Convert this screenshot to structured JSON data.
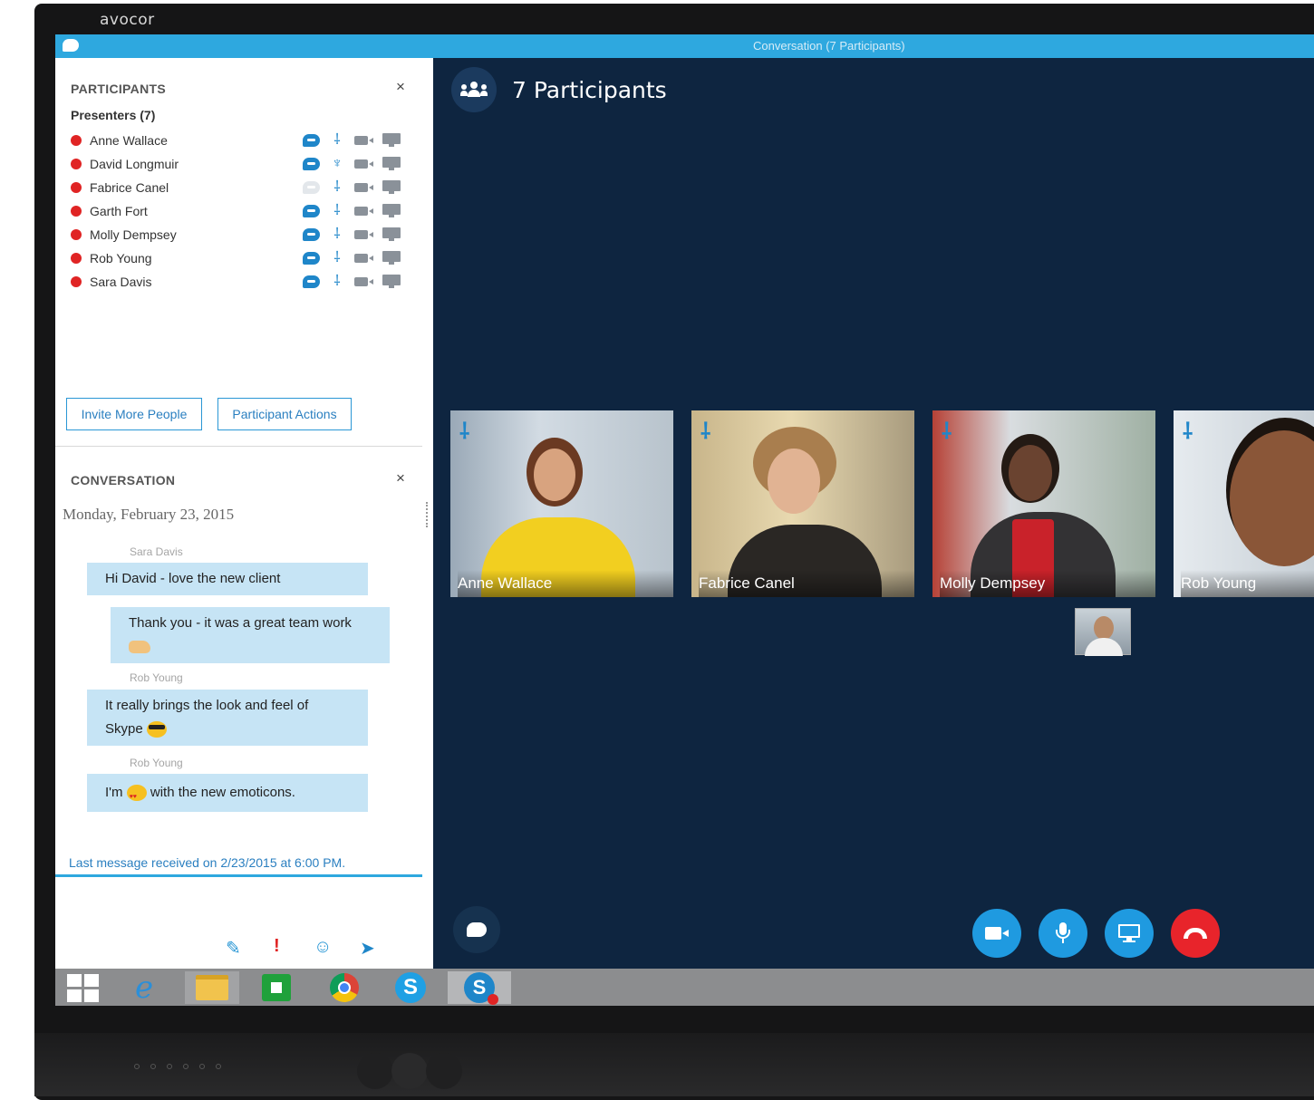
{
  "device": {
    "brand": "avocor"
  },
  "window": {
    "title": "Conversation (7 Participants)"
  },
  "participants_panel": {
    "title": "PARTICIPANTS",
    "close": "×",
    "group_label": "Presenters (7)",
    "people": [
      {
        "name": "Anne Wallace",
        "im": "active",
        "mic": "muted"
      },
      {
        "name": "David Longmuir",
        "im": "active",
        "mic": "on"
      },
      {
        "name": "Fabrice Canel",
        "im": "inactive",
        "mic": "muted"
      },
      {
        "name": "Garth Fort",
        "im": "active",
        "mic": "muted"
      },
      {
        "name": "Molly Dempsey",
        "im": "active",
        "mic": "muted"
      },
      {
        "name": "Rob Young",
        "im": "active",
        "mic": "muted"
      },
      {
        "name": "Sara Davis",
        "im": "active",
        "mic": "muted"
      }
    ],
    "invite_button": "Invite More People",
    "actions_button": "Participant Actions"
  },
  "conversation_panel": {
    "title": "CONVERSATION",
    "close": "×",
    "date": "Monday, February 23, 2015",
    "messages": [
      {
        "sender": "Sara Davis",
        "text": "Hi David - love the new client"
      },
      {
        "sender": "",
        "text_before": "Thank you - it was a great team work",
        "emoji": "thumbs-up"
      },
      {
        "sender": "Rob Young",
        "text_line1": "It really brings the look and feel of",
        "text_line2": "Skype",
        "emoji": "cool"
      },
      {
        "sender": "Rob Young",
        "text_before": "I'm",
        "text_after": "with the new emoticons.",
        "emoji": "heart-eyes"
      }
    ],
    "last_message": "Last message received on 2/23/2015 at 6:00 PM.",
    "compose_icons": [
      "paperclip-icon",
      "priority-icon",
      "emoticon-icon",
      "send-icon"
    ]
  },
  "stage": {
    "title": "7 Participants",
    "tiles": [
      {
        "name": "Anne Wallace",
        "muted": true
      },
      {
        "name": "Fabrice Canel",
        "muted": true
      },
      {
        "name": "Molly Dempsey",
        "muted": true
      },
      {
        "name": "Rob Young",
        "muted": true
      }
    ],
    "controls": [
      "chat-icon",
      "video-icon",
      "microphone-icon",
      "present-screen-icon",
      "hang-up-icon"
    ]
  },
  "taskbar": {
    "apps": [
      "windows-start-icon",
      "internet-explorer-icon",
      "file-explorer-icon",
      "store-icon",
      "chrome-icon",
      "skype-icon",
      "skype-for-business-icon"
    ]
  },
  "colors": {
    "accent": "#2ea8df",
    "stage_bg": "#0e2540",
    "presence_busy": "#e02424",
    "bubble": "#c6e4f5",
    "hangup": "#e8242b",
    "control_blue": "#1f9ae0"
  }
}
